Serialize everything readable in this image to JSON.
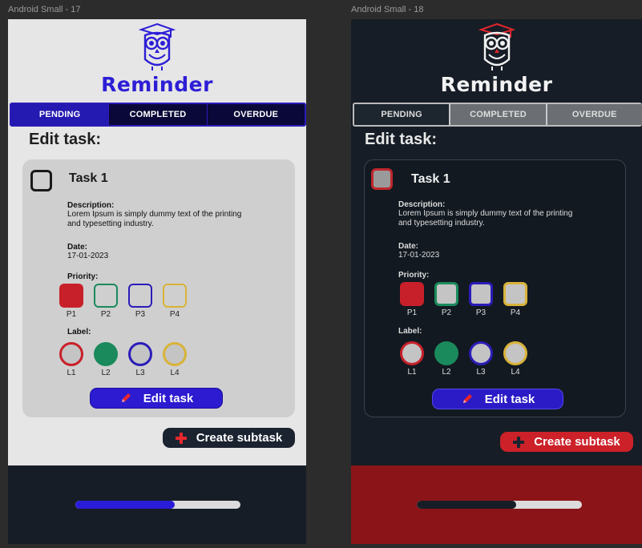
{
  "frames": [
    {
      "frame_label": "Android Small - 17",
      "theme": "light",
      "app_title": "Reminder",
      "tabs": [
        {
          "label": "PENDING",
          "active": true
        },
        {
          "label": "COMPLETED",
          "active": false
        },
        {
          "label": "OVERDUE",
          "active": false
        }
      ],
      "heading": "Edit task:",
      "task": {
        "title": "Task 1",
        "description_label": "Description:",
        "description_value": "Lorem Ipsum is simply dummy text of the printing and typesetting industry.",
        "date_label": "Date:",
        "date_value": "17-01-2023",
        "priority_label": "Priority:",
        "priorities": [
          "P1",
          "P2",
          "P3",
          "P4"
        ],
        "label_label": "Label:",
        "labels": [
          "L1",
          "L2",
          "L3",
          "L4"
        ]
      },
      "edit_button_label": "Edit task",
      "subtask_button_label": "Create subtask",
      "progress_fraction": 0.6
    },
    {
      "frame_label": "Android Small - 18",
      "theme": "dark",
      "app_title": "Reminder",
      "tabs": [
        {
          "label": "PENDING",
          "active": true
        },
        {
          "label": "COMPLETED",
          "active": false
        },
        {
          "label": "OVERDUE",
          "active": false
        }
      ],
      "heading": "Edit task:",
      "task": {
        "title": "Task 1",
        "description_label": "Description:",
        "description_value": "Lorem Ipsum is simply dummy text of the printing and typesetting industry.",
        "date_label": "Date:",
        "date_value": "17-01-2023",
        "priority_label": "Priority:",
        "priorities": [
          "P1",
          "P2",
          "P3",
          "P4"
        ],
        "label_label": "Label:",
        "labels": [
          "L1",
          "L2",
          "L3",
          "L4"
        ]
      },
      "edit_button_label": "Edit task",
      "subtask_button_label": "Create subtask",
      "progress_fraction": 0.6
    }
  ],
  "colors": {
    "p1": "#c8202a",
    "p2": "#1a8a5c",
    "p3": "#2b1cb8",
    "p4": "#d9b338",
    "accent_light": "#2c1bd0",
    "accent_dark": "#cc2129"
  },
  "icons": {
    "logo": "owl-graduate-icon",
    "edit": "pencil-icon",
    "add": "plus-icon"
  }
}
